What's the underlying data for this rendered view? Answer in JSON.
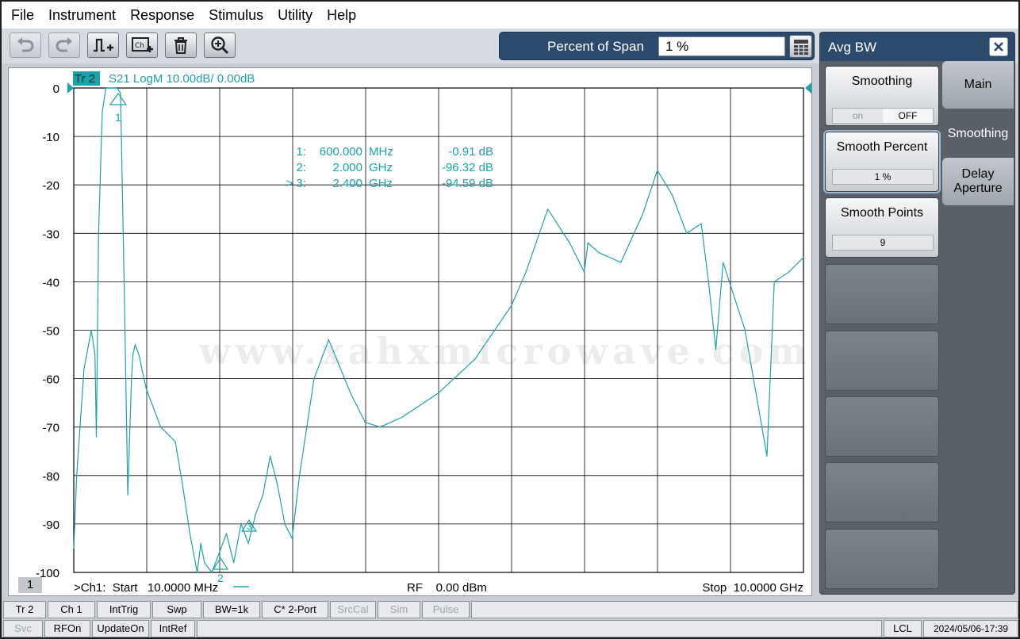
{
  "menu": [
    "File",
    "Instrument",
    "Response",
    "Stimulus",
    "Utility",
    "Help"
  ],
  "toolbar": {
    "buttons": [
      "undo-icon",
      "redo-icon",
      "marker-add-icon",
      "trace-add-icon",
      "trash-icon",
      "zoom-icon"
    ],
    "span_label": "Percent of Span",
    "span_value": "1 %"
  },
  "trace": {
    "tag": "Tr 2",
    "description": "S21 LogM 10.00dB/  0.00dB",
    "color": "#1aa3a8"
  },
  "markers": [
    {
      "id": "1:",
      "freq": "600.000",
      "unit": "MHz",
      "value": "-0.91 dB"
    },
    {
      "id": "2:",
      "freq": "2.000",
      "unit": "GHz",
      "value": "-96.32 dB"
    },
    {
      "id": "> 3:",
      "freq": "2.400",
      "unit": "GHz",
      "value": "-94.59 dB"
    }
  ],
  "marker_labels": [
    "1",
    "2",
    "3"
  ],
  "y_ticks": [
    "0",
    "-10",
    "-20",
    "-30",
    "-40",
    "-50",
    "-60",
    "-70",
    "-80",
    "-90",
    "-100"
  ],
  "footer": {
    "channel_badge": "1",
    "start": ">Ch1:  Start   10.0000 MHz",
    "rf": "RF    0.00 dBm",
    "stop": "Stop  10.0000 GHz"
  },
  "watermark": "www.xahxmicrowave.com",
  "chart_data": {
    "type": "line",
    "title": "",
    "xlabel": "",
    "ylabel": "",
    "x_unit": "GHz",
    "xlim": [
      0.01,
      10.0
    ],
    "ylim": [
      -100,
      0
    ],
    "grid": true,
    "series": [
      {
        "x": [
          0.01,
          0.05,
          0.15,
          0.25,
          0.3,
          0.32,
          0.35,
          0.4,
          0.45,
          0.5,
          0.55,
          0.6,
          0.65,
          0.7,
          0.75,
          0.8,
          0.82,
          0.85,
          0.9,
          1.0,
          1.2,
          1.4,
          1.5,
          1.6,
          1.7,
          1.75,
          1.8,
          1.9,
          2.0,
          2.1,
          2.2,
          2.3,
          2.4,
          2.5,
          2.6,
          2.7,
          2.8,
          2.9,
          3.0,
          3.1,
          3.3,
          3.5,
          3.8,
          4.0,
          4.2,
          4.5,
          5.0,
          5.5,
          6.0,
          6.2,
          6.5,
          6.8,
          7.0,
          7.05,
          7.2,
          7.5,
          7.8,
          8.0,
          8.2,
          8.4,
          8.6,
          8.7,
          8.8,
          8.9,
          9.2,
          9.5,
          9.6,
          9.8,
          10.0
        ],
        "y": [
          -95,
          -80,
          -58,
          -50,
          -55,
          -72,
          -30,
          -5,
          0,
          0,
          0,
          0,
          -1,
          -40,
          -84,
          -60,
          -55,
          -53,
          -55,
          -62,
          -70,
          -73,
          -82,
          -92,
          -100,
          -94,
          -98,
          -100,
          -96,
          -92,
          -98,
          -90,
          -94,
          -88,
          -84,
          -76,
          -82,
          -90,
          -93,
          -80,
          -60,
          -52,
          -63,
          -69,
          -70,
          -68,
          -63,
          -56,
          -45,
          -38,
          -25,
          -32,
          -38,
          -32,
          -34,
          -36,
          -26,
          -17,
          -22,
          -30,
          -28,
          -40,
          -54,
          -36,
          -50,
          -76,
          -40,
          -38,
          -35
        ]
      }
    ]
  },
  "side_panel": {
    "title": "Avg BW",
    "softkeys": [
      {
        "label": "Smoothing",
        "toggle_on": "on",
        "toggle_off": "OFF"
      },
      {
        "label": "Smooth Percent",
        "value": "1 %"
      },
      {
        "label": "Smooth Points",
        "value": "9"
      }
    ],
    "tabs": [
      "Main",
      "Smoothing",
      "Delay\nAperture"
    ]
  },
  "status_row1": [
    "Tr 2",
    "Ch 1",
    "IntTrig",
    "Swp",
    "BW=1k",
    "C* 2-Port",
    "SrcCal",
    "Sim",
    "Pulse"
  ],
  "status_row2": [
    "Svc",
    "RFOn",
    "UpdateOn",
    "IntRef",
    "LCL",
    "2024/05/06-17:39"
  ]
}
